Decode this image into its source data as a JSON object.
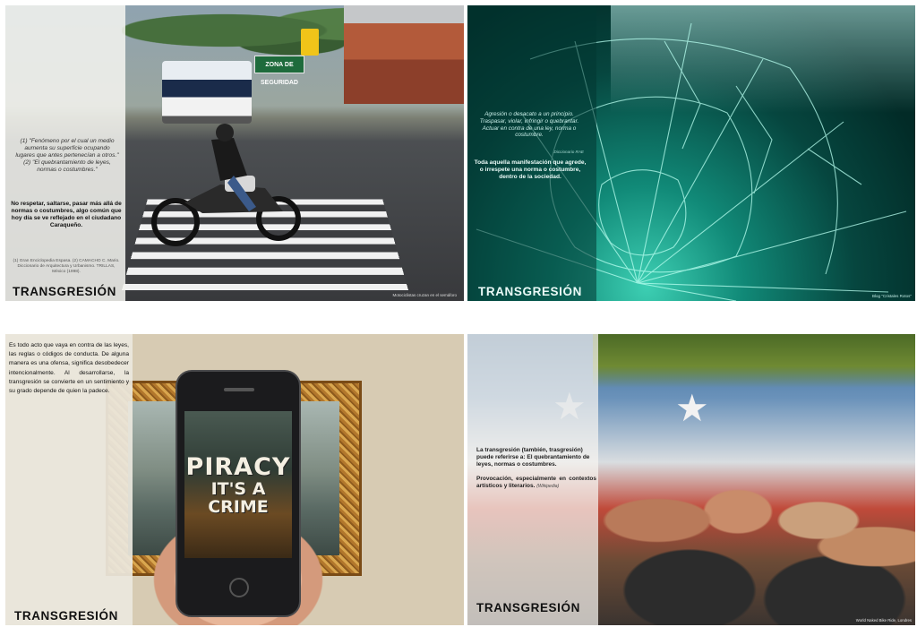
{
  "slides": [
    {
      "heading": "TRANSGRESIÓN",
      "sign": "ZONA DE SEGURIDAD",
      "quote": "(1) \"Fenómeno por el cual un medio aumenta su superficie ocupando lugares que antes pertenecían a otros.\" (2) \"El quebrantamiento de leyes, normas o costumbres.\"",
      "definition": "No respetar, saltarse, pasar más allá de normas o costumbres, algo común que hoy día se ve reflejado en el ciudadano Caraqueño.",
      "references": "(1) Gran Enciclopedia Espasa. (2) CAMACHO C. Mario. Diccionario de Arquitectura y Urbanismo. TRILLAS, México (1998).",
      "credit": "Motociclistas cruzan en el semáforo"
    },
    {
      "heading": "TRANSGRESIÓN",
      "quote": "Agresión o desacato a un principio. Traspasar, violar, infringir o quebrantar. Actuar en contra de una ley, norma o costumbre.",
      "quote_source": "Diccionario RAE",
      "definition": "Toda aquella manifestación que agrede, o irrespete una norma o costumbre, dentro de la sociedad.",
      "credit": "Blog \"Cristales Rotos\""
    },
    {
      "heading": "TRANSGRESIÓN",
      "definition": "Es todo acto que vaya en contra de las leyes, las reglas o códigos de conducta. De alguna manera es una ofensa, significa desobedecer intencionalmente. Al desarrollarse, la transgresión se convierte en un sentimiento y su grado depende de quien la padece.",
      "phone_title": "PIRACY",
      "phone_subtitle": "IT'S A CRIME"
    },
    {
      "heading": "TRANSGRESIÓN",
      "definition": "La transgresión (también, trasgresión) puede referirse a: El quebrantamiento de leyes, normas o costumbres.",
      "definition2": "Provocación, especialmente en contextos artísticos y literarios.",
      "definition2_source": "(Wikipedia)",
      "credit": "World Naked Bike Ride, Londres"
    }
  ],
  "colors": {
    "glass_green": "#118a78",
    "frame_gold": "#b2772c",
    "sign_green": "#1e6b3c"
  }
}
